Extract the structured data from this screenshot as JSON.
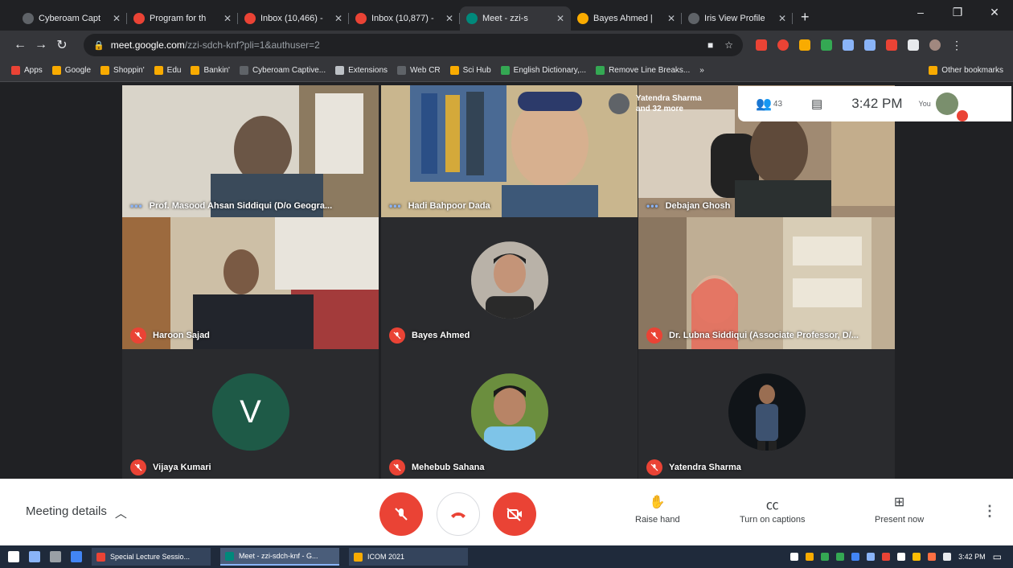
{
  "browser": {
    "tabs": [
      {
        "title": "Cyberoam Capt",
        "favicon": "globe-icon",
        "color": "#5f6368",
        "active": false
      },
      {
        "title": "Program for th",
        "favicon": "gmail-icon",
        "color": "#ea4335",
        "active": false
      },
      {
        "title": "Inbox (10,466) -",
        "favicon": "gmail-icon",
        "color": "#ea4335",
        "active": false
      },
      {
        "title": "Inbox (10,877) -",
        "favicon": "gmail-icon",
        "color": "#ea4335",
        "active": false
      },
      {
        "title": "Meet - zzi-s",
        "favicon": "meet-icon",
        "color": "#00897b",
        "active": true
      },
      {
        "title": "Bayes Ahmed |",
        "favicon": "scholar-icon",
        "color": "#f9ab00",
        "active": false
      },
      {
        "title": "Iris View Profile",
        "favicon": "globe-icon",
        "color": "#5f6368",
        "active": false
      }
    ],
    "new_tab": "+",
    "window_controls": [
      "–",
      "❐",
      "✕"
    ],
    "url_host": "meet.google.com",
    "url_path": "/zzi-sdch-knf?pli=1&authuser=2",
    "bookmarks": [
      {
        "label": "Apps",
        "color": "#ea4335"
      },
      {
        "label": "Google",
        "color": "#f9ab00"
      },
      {
        "label": "Shoppin'",
        "color": "#f9ab00"
      },
      {
        "label": "Edu",
        "color": "#f9ab00"
      },
      {
        "label": "Bankin'",
        "color": "#f9ab00"
      },
      {
        "label": "Cyberoam Captive...",
        "color": "#5f6368"
      },
      {
        "label": "Extensions",
        "color": "#bdc1c6"
      },
      {
        "label": "Web CR",
        "color": "#5f6368"
      },
      {
        "label": "Sci Hub",
        "color": "#f9ab00"
      },
      {
        "label": "English Dictionary,...",
        "color": "#34a853"
      },
      {
        "label": "Remove Line Breaks...",
        "color": "#34a853"
      }
    ],
    "bookmarks_more": "»",
    "other_bookmarks": "Other bookmarks"
  },
  "meet": {
    "participants": [
      {
        "name": "Prof. Masood Ahsan Siddiqui (D/o Geogra...",
        "muted": false,
        "speaking": true,
        "type": "video"
      },
      {
        "name": "Hadi Bahpoor Dada",
        "muted": false,
        "speaking": true,
        "type": "video"
      },
      {
        "name": "Debajan Ghosh",
        "muted": false,
        "speaking": true,
        "type": "video"
      },
      {
        "name": "Haroon Sajad",
        "muted": true,
        "speaking": false,
        "type": "video"
      },
      {
        "name": "Bayes Ahmed",
        "muted": true,
        "speaking": false,
        "type": "avatar"
      },
      {
        "name": "Dr. Lubna Siddiqui (Associate Professor, D/...",
        "muted": true,
        "speaking": false,
        "type": "video"
      },
      {
        "name": "Vijaya Kumari",
        "muted": true,
        "speaking": false,
        "type": "letter",
        "letter": "V"
      },
      {
        "name": "Mehebub Sahana",
        "muted": true,
        "speaking": false,
        "type": "avatar"
      },
      {
        "name": "Yatendra Sharma",
        "muted": true,
        "speaking": false,
        "type": "avatar"
      }
    ],
    "overlay": {
      "presenter": "Yatendra Sharma",
      "more": "and 32 more"
    },
    "top_bar": {
      "people_count": "43",
      "clock": "3:42 PM",
      "you_label": "You"
    },
    "controls": {
      "meeting_details": "Meeting details",
      "raise_hand": "Raise hand",
      "captions": "Turn on captions",
      "present": "Present now"
    }
  },
  "taskbar": {
    "apps": [
      {
        "label": "Special Lecture Sessio...",
        "active": false,
        "color": "#ea4335"
      },
      {
        "label": "Meet - zzi-sdch-knf - G...",
        "active": true,
        "color": "#00897b"
      },
      {
        "label": "ICOM 2021",
        "active": false,
        "color": "#f9ab00"
      }
    ],
    "clock": "3:42 PM"
  }
}
